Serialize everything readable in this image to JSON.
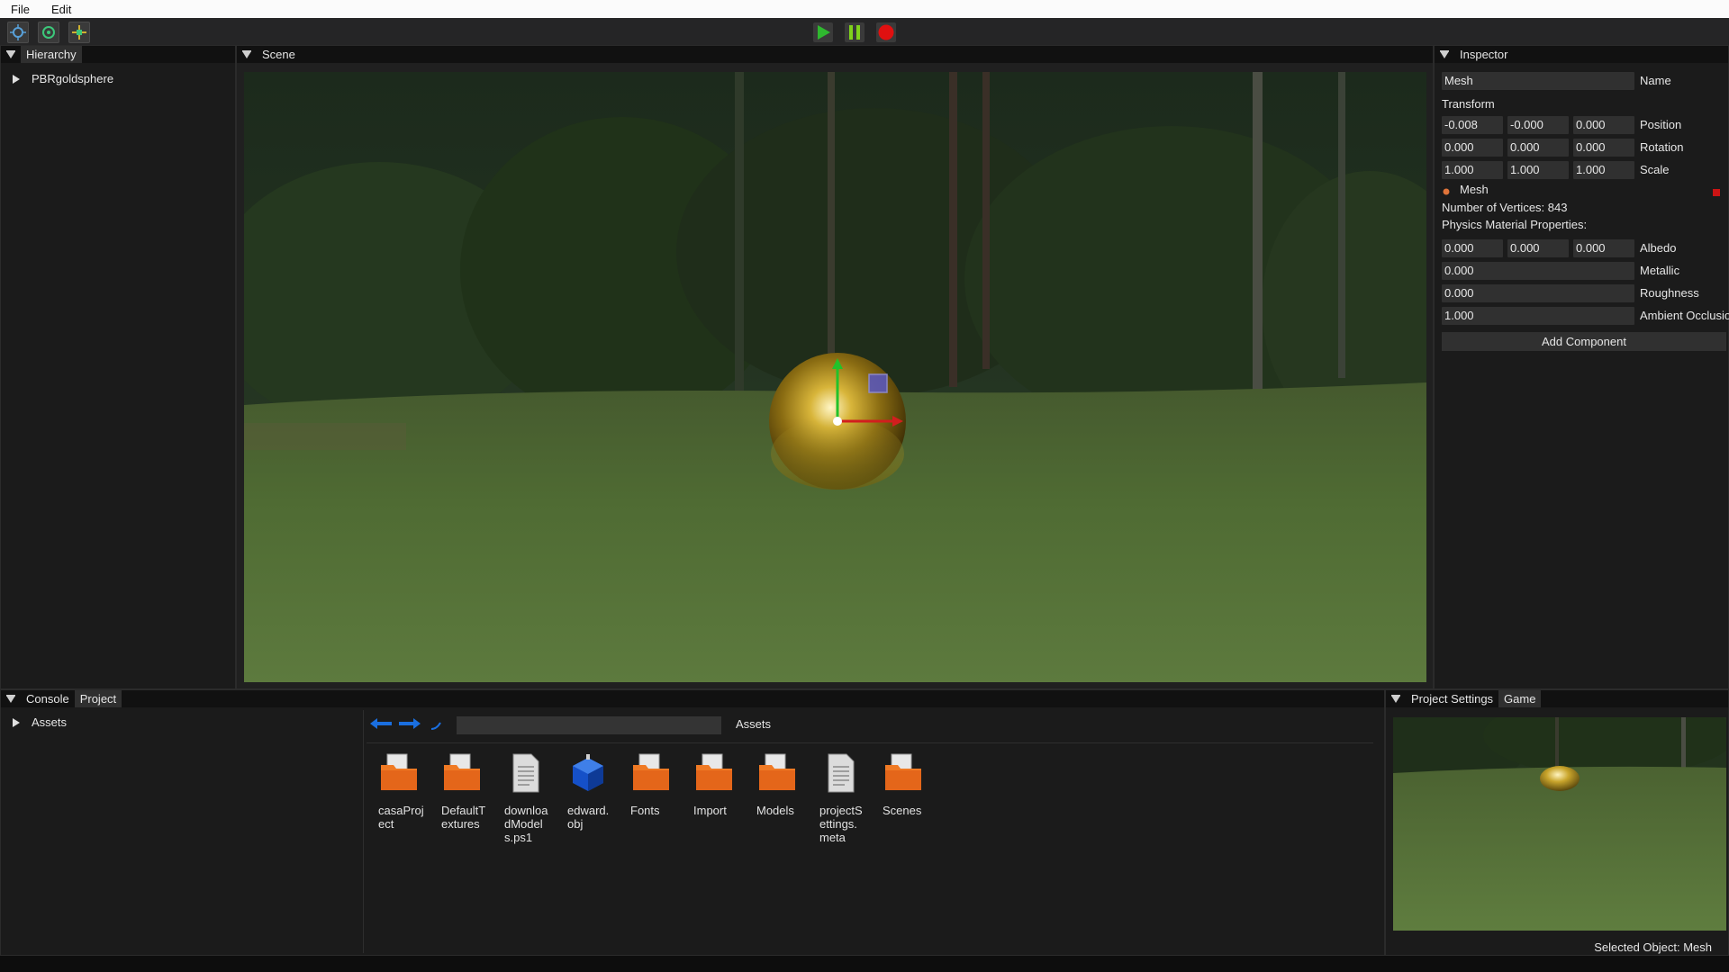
{
  "menu": {
    "file": "File",
    "edit": "Edit"
  },
  "toolbar": {
    "tools": [
      "move-tool-icon",
      "rotate-tool-icon",
      "scale-tool-icon"
    ],
    "play_icon": "play-icon",
    "pause_icon": "pause-icon",
    "stop_icon": "stop-icon",
    "colors": {
      "play": "#2fb82f",
      "pause": "#7fd21b",
      "stop": "#e01010"
    }
  },
  "hierarchy": {
    "title": "Hierarchy",
    "items": [
      {
        "label": "PBRgoldsphere"
      }
    ]
  },
  "scene": {
    "title": "Scene"
  },
  "inspector": {
    "title": "Inspector",
    "name_value": "Mesh",
    "name_label": "Name",
    "transform_title": "Transform",
    "position": {
      "label": "Position",
      "values": [
        "-0.008",
        "-0.000",
        "0.000"
      ]
    },
    "rotation": {
      "label": "Rotation",
      "values": [
        "0.000",
        "0.000",
        "0.000"
      ]
    },
    "scale": {
      "label": "Scale",
      "values": [
        "1.000",
        "1.000",
        "1.000"
      ]
    },
    "mesh_title": "Mesh",
    "vertices": "Number of Vertices: 843",
    "physics_title": "Physics Material Properties:",
    "albedo": {
      "label": "Albedo",
      "values": [
        "0.000",
        "0.000",
        "0.000"
      ]
    },
    "metallic": {
      "label": "Metallic",
      "value": "0.000"
    },
    "roughness": {
      "label": "Roughness",
      "value": "0.000"
    },
    "ao": {
      "label": "Ambient Occlusio",
      "value": "1.000"
    },
    "add_component": "Add Component"
  },
  "bottom": {
    "tabs": {
      "console": "Console",
      "project": "Project"
    },
    "tree_root": "Assets",
    "breadcrumb": "Assets",
    "path_value": "",
    "assets": [
      {
        "name": "casaProject",
        "icon": "folder-icon"
      },
      {
        "name": "DefaultTextures",
        "icon": "folder-icon"
      },
      {
        "name": "downloadModels.ps1",
        "icon": "file-icon"
      },
      {
        "name": "edward.obj",
        "icon": "model-cube-icon"
      },
      {
        "name": "Fonts",
        "icon": "folder-icon"
      },
      {
        "name": "Import",
        "icon": "folder-icon"
      },
      {
        "name": "Models",
        "icon": "folder-icon"
      },
      {
        "name": "projectSettings.meta",
        "icon": "file-icon"
      },
      {
        "name": "Scenes",
        "icon": "folder-icon"
      }
    ]
  },
  "game": {
    "tabs": {
      "settings": "Project Settings",
      "game": "Game"
    }
  },
  "status": {
    "text": "Selected Object: Mesh"
  },
  "colors": {
    "folder": "#f07a24",
    "accent_blue": "#1a6fe0",
    "gizmo_x": "#d21e1e",
    "gizmo_y": "#22c22a",
    "gizmo_z": "#5a57b8"
  }
}
